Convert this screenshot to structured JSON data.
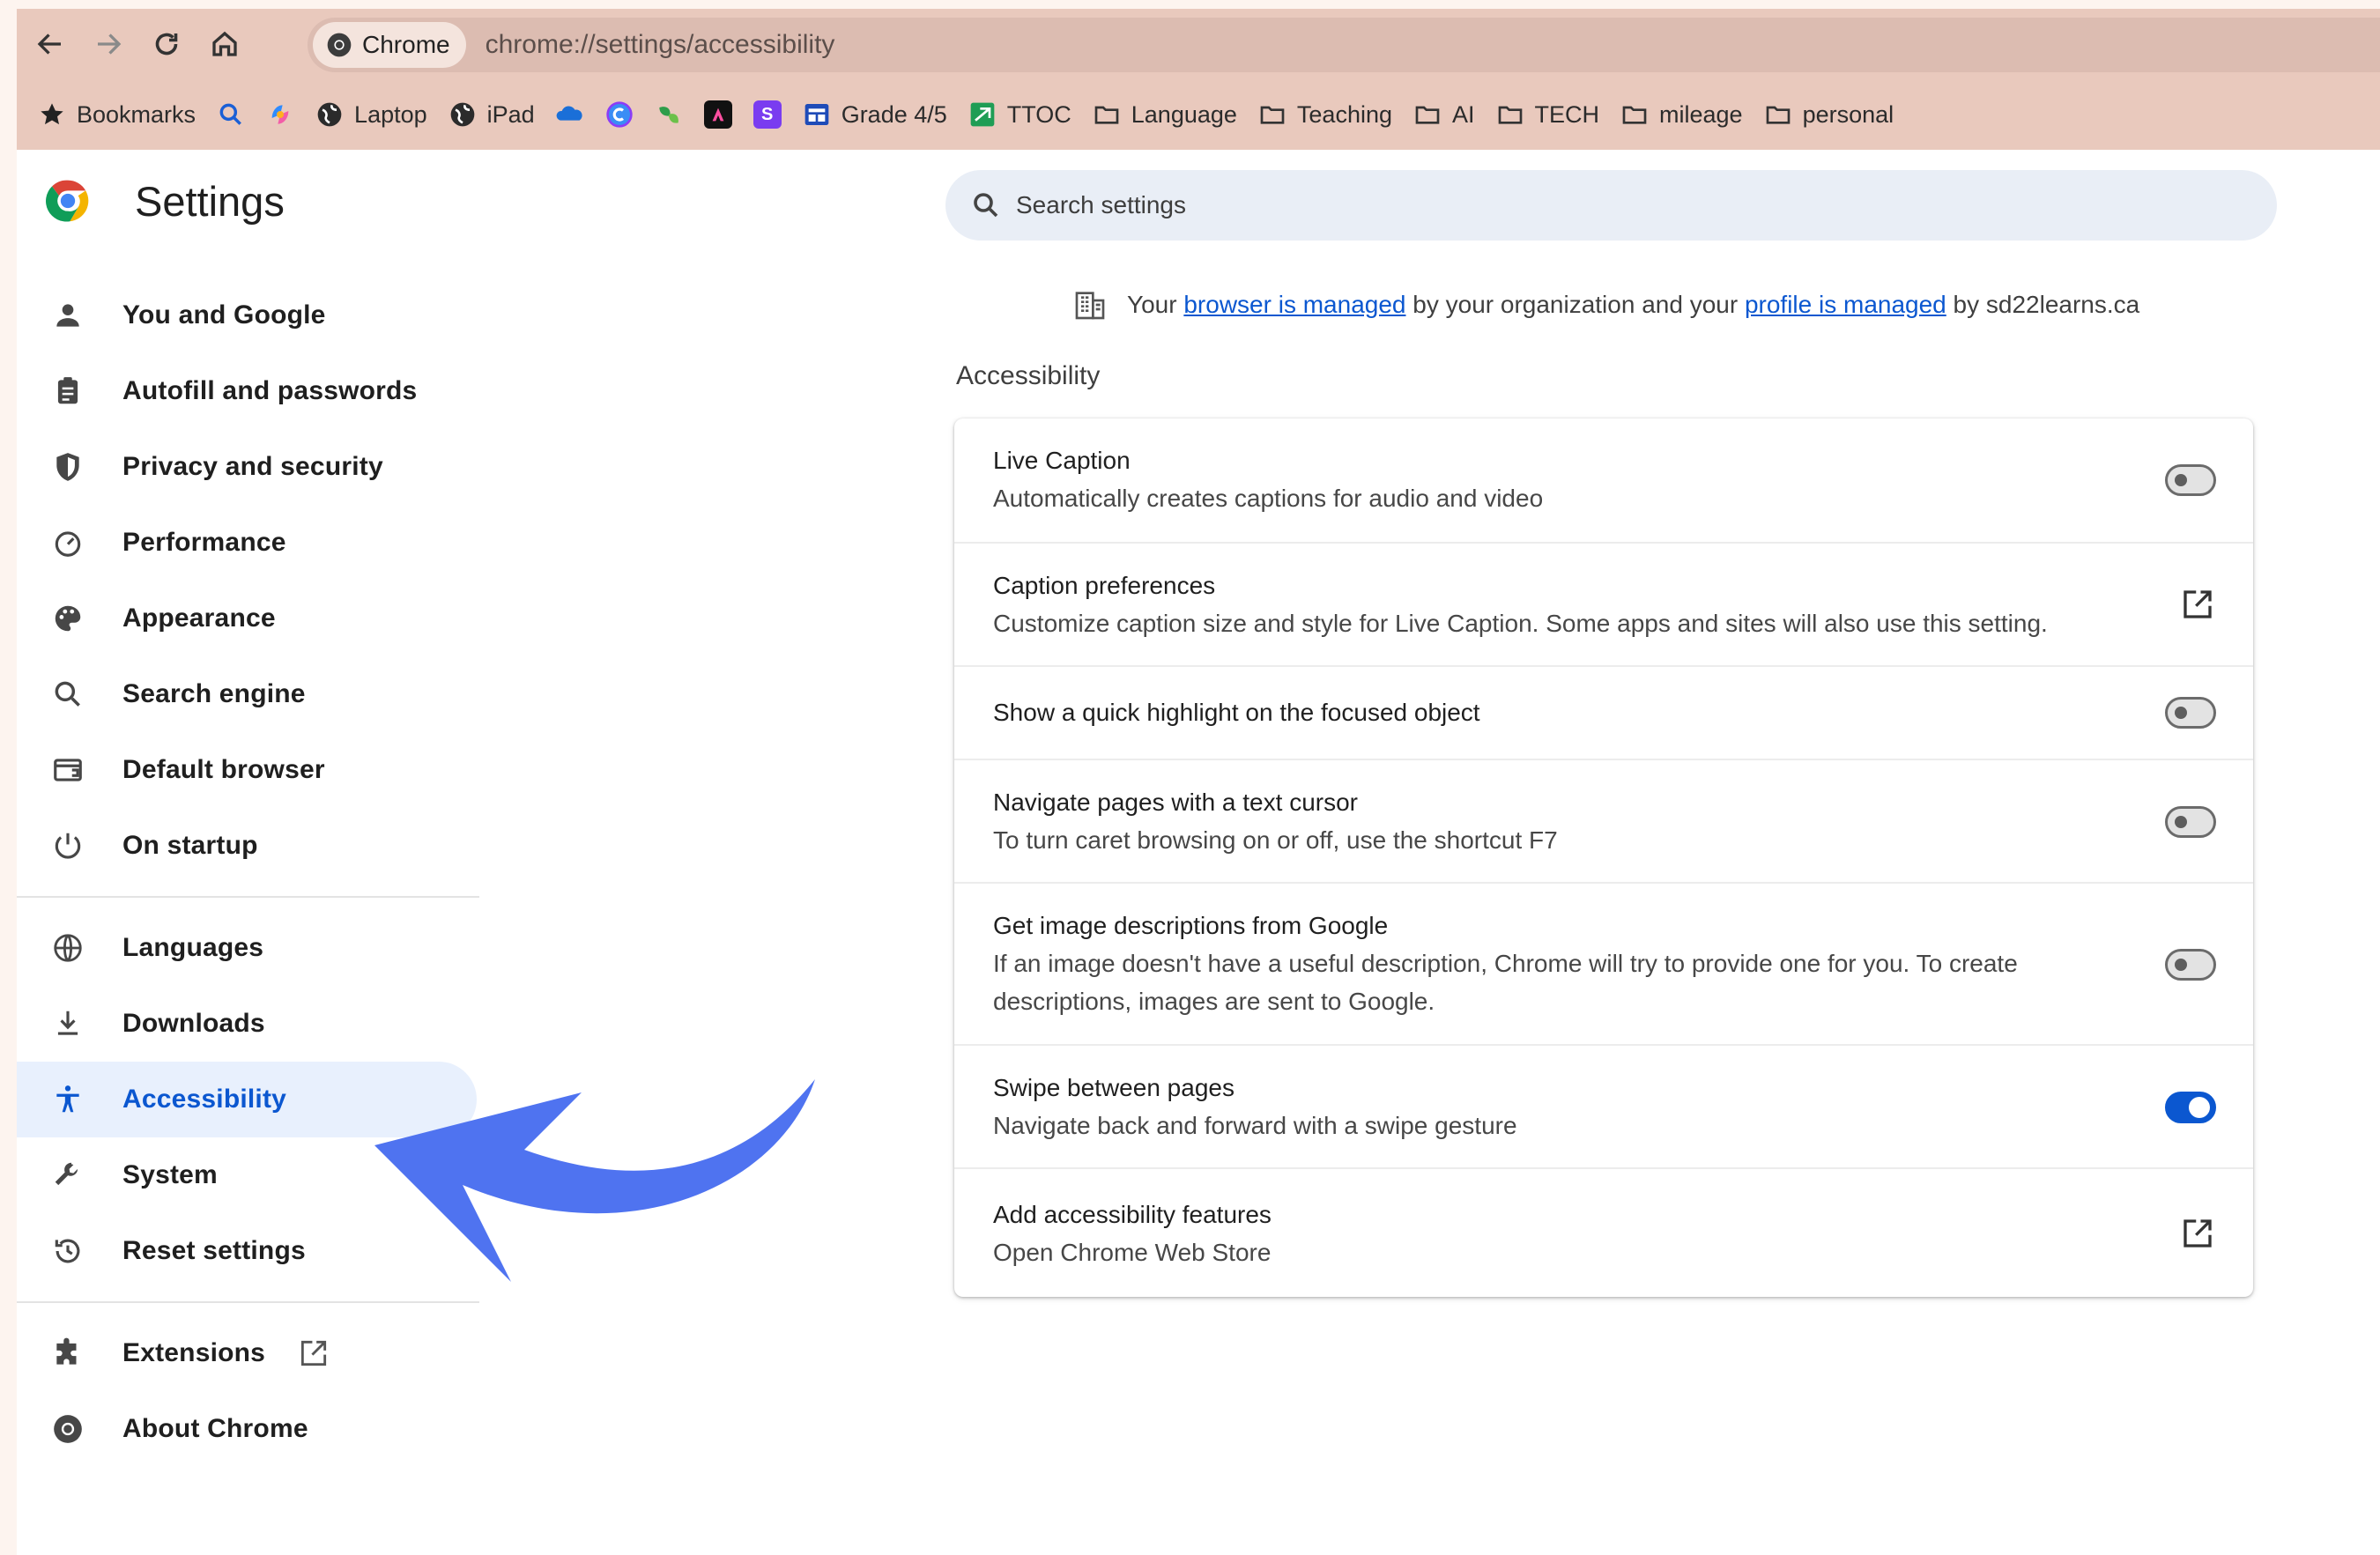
{
  "browser": {
    "chip_label": "Chrome",
    "url": "chrome://settings/accessibility"
  },
  "bookmarks": [
    {
      "label": "Bookmarks",
      "icon": "star-icon"
    },
    {
      "label": "",
      "icon": "search-icon"
    },
    {
      "label": "",
      "icon": "copilot-icon"
    },
    {
      "label": "Laptop",
      "icon": "globe-icon"
    },
    {
      "label": "iPad",
      "icon": "globe-icon"
    },
    {
      "label": "",
      "icon": "onedrive-icon"
    },
    {
      "label": "",
      "icon": "canva-icon"
    },
    {
      "label": "",
      "icon": "leaf-icon"
    },
    {
      "label": "",
      "icon": "a-app-icon"
    },
    {
      "label": "",
      "icon": "s-app-icon"
    },
    {
      "label": "Grade 4/5",
      "icon": "classroom-icon"
    },
    {
      "label": "TTOC",
      "icon": "ttoc-icon"
    },
    {
      "label": "Language",
      "icon": "folder-icon"
    },
    {
      "label": "Teaching",
      "icon": "folder-icon"
    },
    {
      "label": "AI",
      "icon": "folder-icon"
    },
    {
      "label": "TECH",
      "icon": "folder-icon"
    },
    {
      "label": "mileage",
      "icon": "folder-icon"
    },
    {
      "label": "personal",
      "icon": "folder-icon"
    }
  ],
  "settings": {
    "title": "Settings",
    "search_placeholder": "Search settings"
  },
  "sidebar": {
    "group1": [
      {
        "label": "You and Google",
        "icon": "person-icon"
      },
      {
        "label": "Autofill and passwords",
        "icon": "clipboard-icon"
      },
      {
        "label": "Privacy and security",
        "icon": "shield-icon"
      },
      {
        "label": "Performance",
        "icon": "speedometer-icon"
      },
      {
        "label": "Appearance",
        "icon": "palette-icon"
      },
      {
        "label": "Search engine",
        "icon": "search-icon"
      },
      {
        "label": "Default browser",
        "icon": "browser-window-icon"
      },
      {
        "label": "On startup",
        "icon": "power-icon"
      }
    ],
    "group2": [
      {
        "label": "Languages",
        "icon": "globe-icon"
      },
      {
        "label": "Downloads",
        "icon": "download-icon"
      },
      {
        "label": "Accessibility",
        "icon": "accessibility-icon",
        "active": true
      },
      {
        "label": "System",
        "icon": "wrench-icon"
      },
      {
        "label": "Reset settings",
        "icon": "history-icon"
      }
    ],
    "group3": [
      {
        "label": "Extensions",
        "icon": "puzzle-icon"
      },
      {
        "label": "About Chrome",
        "icon": "chrome-icon"
      }
    ]
  },
  "managed_notice": {
    "prefix": "Your",
    "link1": "browser is managed",
    "middle": "by your organization and your",
    "link2": "profile is managed",
    "suffix": "by sd22learns.ca"
  },
  "section_title": "Accessibility",
  "rows": [
    {
      "label": "Live Caption",
      "sub": "Automatically creates captions for audio and video",
      "control": "toggle",
      "on": false
    },
    {
      "label": "Caption preferences",
      "sub": "Customize caption size and style for Live Caption. Some apps and sites will also use this setting.",
      "control": "external"
    },
    {
      "label": "Show a quick highlight on the focused object",
      "sub": "",
      "control": "toggle",
      "on": false
    },
    {
      "label": "Navigate pages with a text cursor",
      "sub": "To turn caret browsing on or off, use the shortcut F7",
      "control": "toggle",
      "on": false
    },
    {
      "label": "Get image descriptions from Google",
      "sub": "If an image doesn't have a useful description, Chrome will try to provide one for you. To create",
      "sub2": "descriptions, images are sent to Google.",
      "control": "toggle",
      "on": false
    },
    {
      "label": "Swipe between pages",
      "sub": "Navigate back and forward with a swipe gesture",
      "control": "toggle",
      "on": true
    },
    {
      "label": "Add accessibility features",
      "sub": "Open Chrome Web Store",
      "control": "external"
    }
  ],
  "colors": {
    "accent": "#0b57d0",
    "active_bg": "#e8f0fd",
    "toolbar": "#e9c9bd",
    "annotation_arrow": "#4f73f0"
  }
}
